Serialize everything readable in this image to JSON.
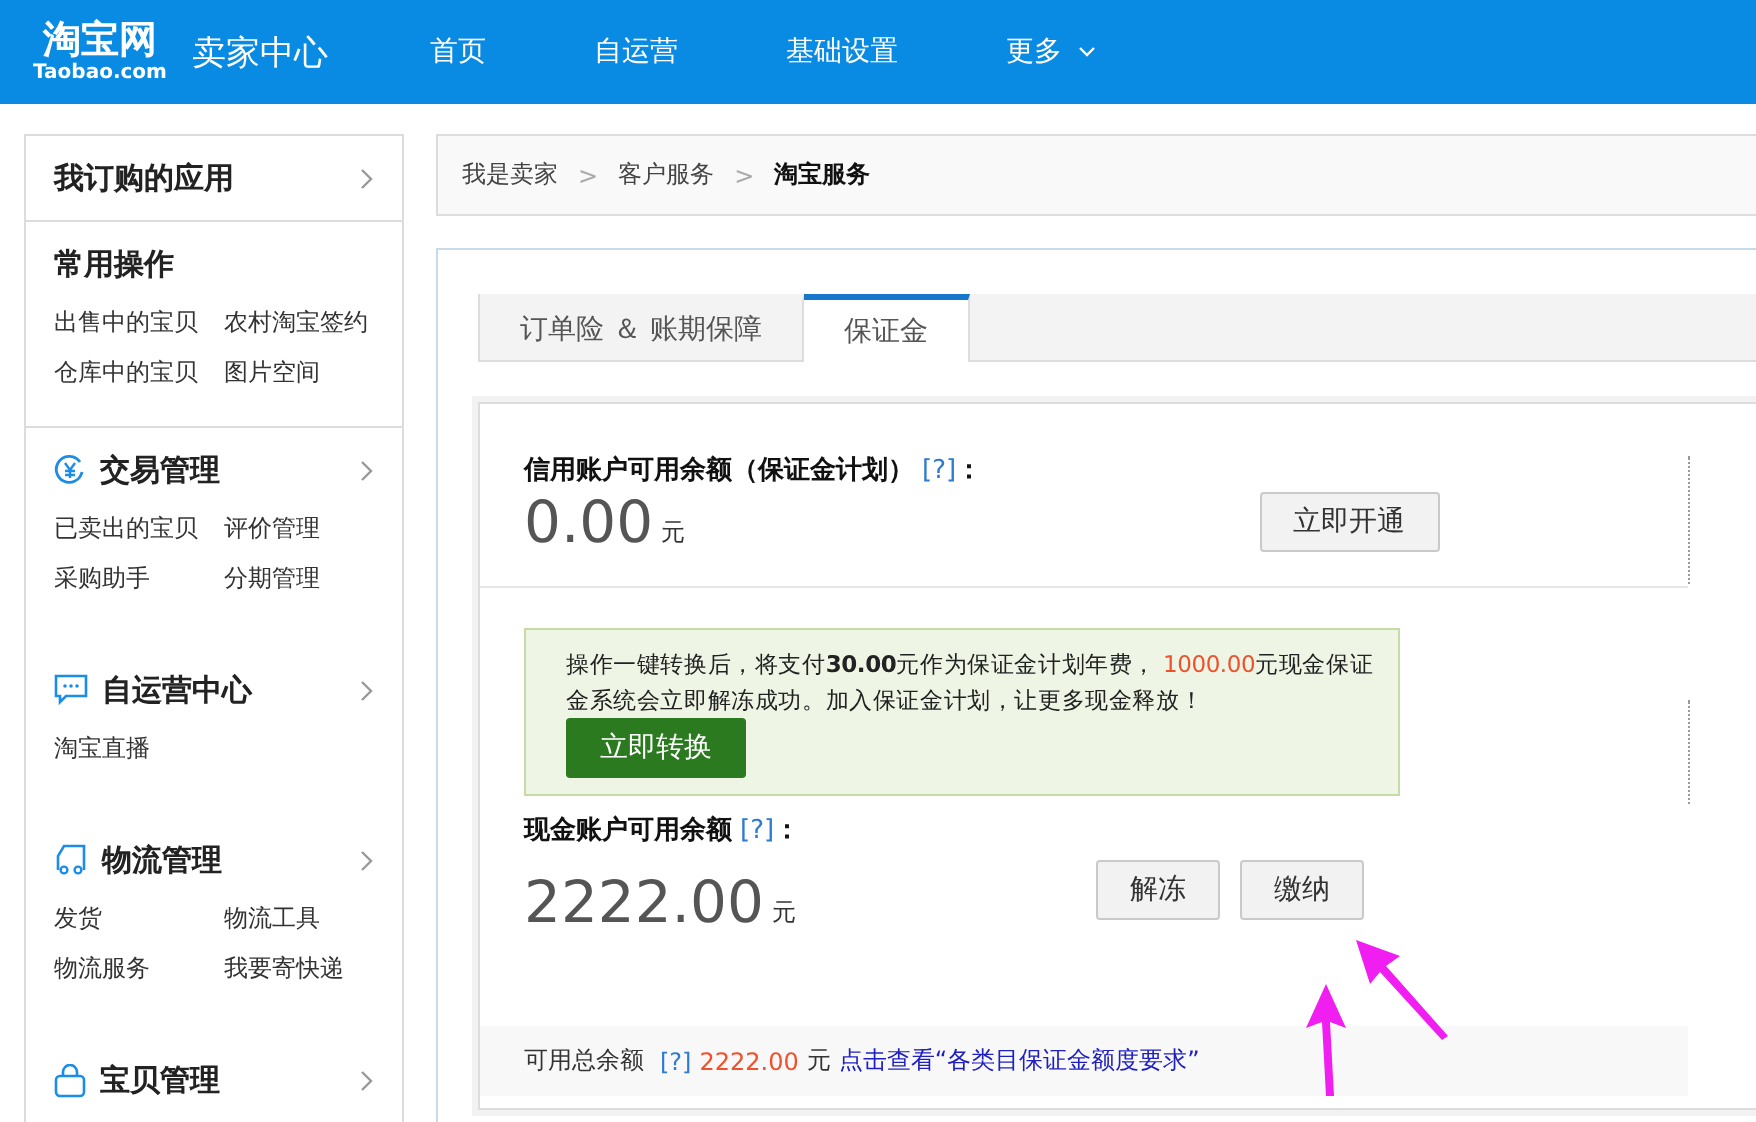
{
  "header": {
    "logo": {
      "name": "淘宝网",
      "domain": "Taobao.com"
    },
    "title": "卖家中心",
    "nav": [
      {
        "label": "首页",
        "dropdown": false
      },
      {
        "label": "自运营",
        "dropdown": false
      },
      {
        "label": "基础设置",
        "dropdown": false
      },
      {
        "label": "更多",
        "dropdown": true
      }
    ]
  },
  "sidebar": {
    "sections": [
      {
        "title": "我订购的应用",
        "arrow": true
      },
      {
        "title": "常用操作",
        "arrow": false,
        "items": [
          "出售中的宝贝",
          "农村淘宝签约",
          "仓库中的宝贝",
          "图片空间"
        ]
      },
      {
        "title": "交易管理",
        "arrow": true,
        "items": [
          "已卖出的宝贝",
          "评价管理",
          "采购助手",
          "分期管理"
        ]
      },
      {
        "title": "自运营中心",
        "arrow": true,
        "items": [
          "淘宝直播"
        ]
      },
      {
        "title": "物流管理",
        "arrow": true,
        "items": [
          "发货",
          "物流工具",
          "物流服务",
          "我要寄快递"
        ]
      },
      {
        "title": "宝贝管理",
        "arrow": true
      }
    ]
  },
  "breadcrumb": {
    "separator": ">",
    "items": [
      {
        "label": "我是卖家",
        "current": false
      },
      {
        "label": "客户服务",
        "current": false
      },
      {
        "label": "淘宝服务",
        "current": true
      }
    ]
  },
  "tabs": [
    {
      "label": "订单险 ＆ 账期保障",
      "selected": false
    },
    {
      "label": "保证金",
      "selected": true
    }
  ],
  "credit": {
    "label": "信用账户可用余额（保证金计划）",
    "help": "[?]",
    "colon": "：",
    "amount": "0.00",
    "unit": "元",
    "button": "立即开通"
  },
  "notice": {
    "text_before": "操作一键转换后，将支付**30.00**元作为保证金计划年费， ",
    "amount": "1000.00",
    "text_after": "元现金保证金系统会立即解冻成功。加入保证金计划，让更多现金释放！",
    "button": "立即转换"
  },
  "cash": {
    "label": "现金账户可用余额",
    "help": "[?]",
    "colon": "：",
    "amount": "2222.00",
    "unit": "元",
    "buttons": [
      "解冻",
      "缴纳"
    ]
  },
  "footer": {
    "label": "可用总余额",
    "help": "[?]",
    "amount": "2222.00",
    "unit": "元",
    "link": "点击查看“各类目保证金额度要求”"
  }
}
